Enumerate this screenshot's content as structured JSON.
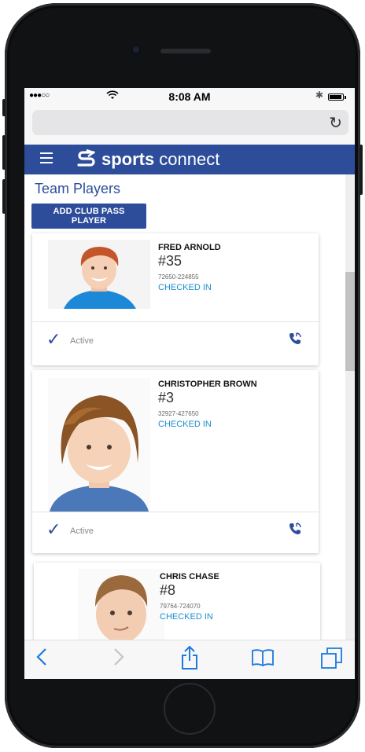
{
  "status_bar": {
    "signal": "●●●○○",
    "time": "8:08 AM"
  },
  "browser": {
    "reload_glyph": "↻"
  },
  "app_bar": {
    "menu_icon": "hamburger-icon",
    "logo_bold": "sports",
    "logo_thin": "connect"
  },
  "page": {
    "title": "Team Players",
    "add_button": "ADD CLUB PASS PLAYER"
  },
  "players": [
    {
      "name": "FRED ARNOLD",
      "number": "#35",
      "id": "72650-224855",
      "status": "CHECKED IN",
      "active_label": "Active"
    },
    {
      "name": "CHRISTOPHER BROWN",
      "number": "#3",
      "id": "32927-427650",
      "status": "CHECKED IN",
      "active_label": "Active"
    },
    {
      "name": "CHRIS CHASE",
      "number": "#8",
      "id": "79764-724070",
      "status": "CHECKED IN"
    }
  ],
  "colors": {
    "brand": "#2d4d9b",
    "status": "#1a8fd1",
    "ios_blue": "#1a7ae0"
  },
  "toolbar": {
    "icons": [
      "back-icon",
      "forward-icon",
      "share-icon",
      "bookmarks-icon",
      "tabs-icon"
    ]
  }
}
